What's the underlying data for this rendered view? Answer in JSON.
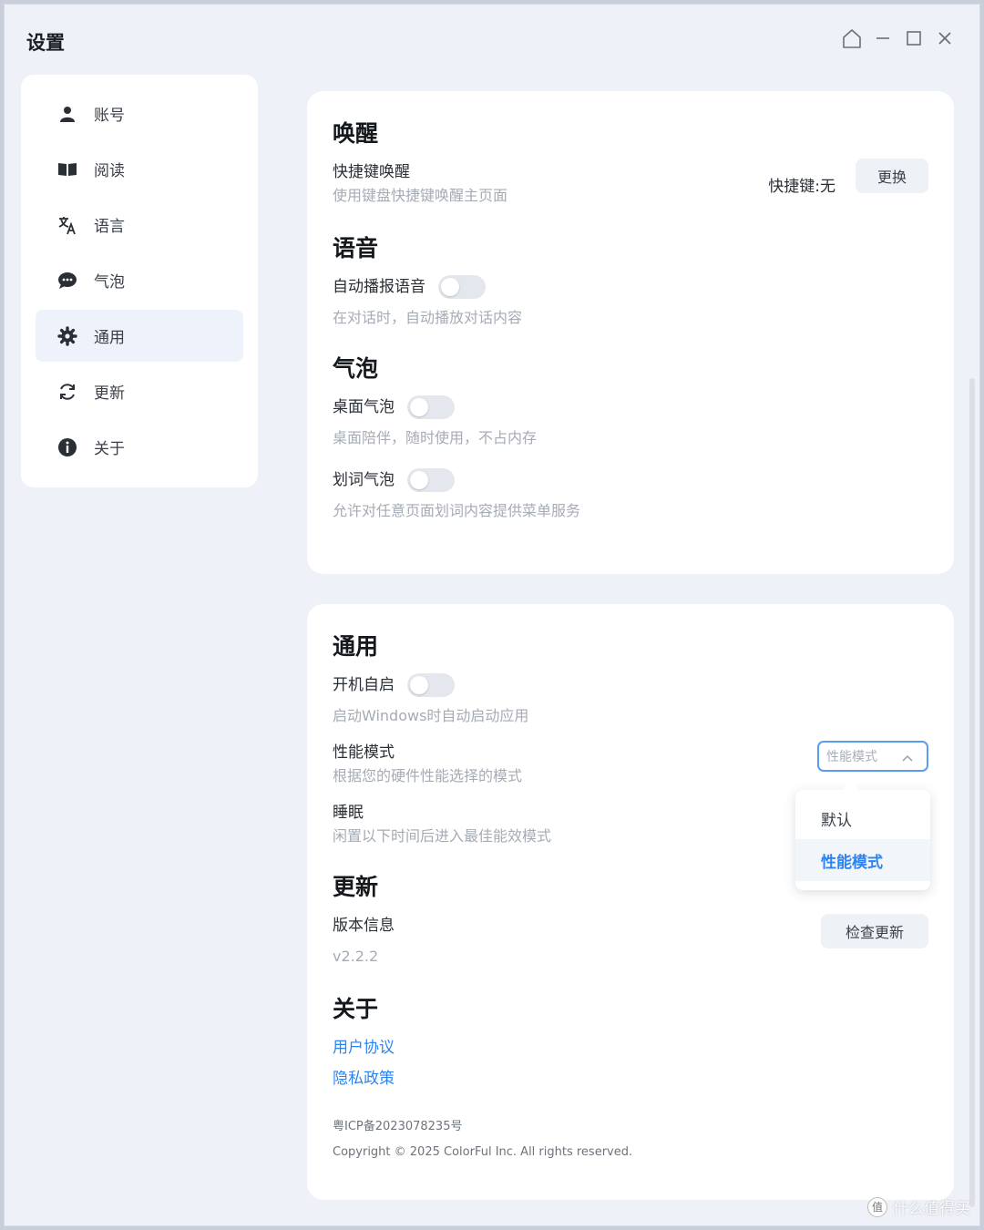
{
  "window": {
    "title": "设置"
  },
  "sidebar": {
    "items": [
      {
        "label": "账号",
        "icon": "user-icon",
        "active": false
      },
      {
        "label": "阅读",
        "icon": "book-icon",
        "active": false
      },
      {
        "label": "语言",
        "icon": "translate-icon",
        "active": false
      },
      {
        "label": "气泡",
        "icon": "chat-bubble-icon",
        "active": false
      },
      {
        "label": "通用",
        "icon": "gear-icon",
        "active": true
      },
      {
        "label": "更新",
        "icon": "refresh-icon",
        "active": false
      },
      {
        "label": "关于",
        "icon": "info-icon",
        "active": false
      }
    ]
  },
  "wake": {
    "title": "唤醒",
    "shortcut_label": "快捷键唤醒",
    "shortcut_desc": "使用键盘快捷键唤醒主页面",
    "shortcut_value": "快捷键:无",
    "change_button": "更换"
  },
  "voice": {
    "title": "语音",
    "auto_play_label": "自动播报语音",
    "auto_play_desc": "在对话时，自动播放对话内容",
    "auto_play_on": false
  },
  "bubble": {
    "title": "气泡",
    "desktop_label": "桌面气泡",
    "desktop_desc": "桌面陪伴，随时使用，不占内存",
    "desktop_on": false,
    "select_label": "划词气泡",
    "select_desc": "允许对任意页面划词内容提供菜单服务",
    "select_on": false
  },
  "general": {
    "title": "通用",
    "autostart_label": "开机自启",
    "autostart_desc": "启动Windows时自动启动应用",
    "autostart_on": false,
    "perf_label": "性能模式",
    "perf_desc": "根据您的硬件性能选择的模式",
    "perf_select_placeholder": "性能模式",
    "perf_options": [
      "默认",
      "性能模式"
    ],
    "perf_selected": "性能模式",
    "sleep_label": "睡眠",
    "sleep_desc": "闲置以下时间后进入最佳能效模式"
  },
  "update": {
    "title": "更新",
    "version_label": "版本信息",
    "version_value": "v2.2.2",
    "check_button": "检查更新"
  },
  "about": {
    "title": "关于",
    "user_agreement": "用户协议",
    "privacy_policy": "隐私政策",
    "icp": "粤ICP备2023078235号",
    "copyright": "Copyright © 2025 ColorFul Inc. All rights reserved."
  },
  "watermark": {
    "badge": "值",
    "text": "什么值得买"
  },
  "colors": {
    "accent": "#2d84f0",
    "select_border": "#5a9cf2",
    "window_bg": "#eef1f8"
  }
}
